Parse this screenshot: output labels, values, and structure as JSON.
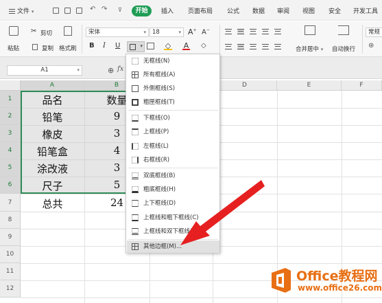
{
  "menubar": {
    "file_label": "文件",
    "tabs": [
      "开始",
      "插入",
      "页面布局",
      "公式",
      "数据",
      "审阅",
      "视图",
      "安全",
      "开发工具"
    ]
  },
  "ribbon": {
    "clipboard": {
      "cut": "剪切",
      "copy": "复制",
      "paste": "粘贴",
      "format_painter": "格式刷"
    },
    "font_name": "宋体",
    "font_size": "18",
    "merge_center": "合并居中",
    "wrap_text": "自动换行",
    "number_format": "常规"
  },
  "formula": {
    "cell_ref": "A1",
    "fx": "fx"
  },
  "sheet": {
    "columns": [
      "A",
      "B",
      "C",
      "D",
      "E",
      "F"
    ],
    "rows": [
      "1",
      "2",
      "3",
      "4",
      "5",
      "6",
      "7",
      "8",
      "9",
      "10",
      "11",
      "12"
    ],
    "cells": [
      [
        "品名",
        "数量"
      ],
      [
        "铅笔",
        "9"
      ],
      [
        "橡皮",
        "3"
      ],
      [
        "铅笔盒",
        "4"
      ],
      [
        "涂改液",
        "3"
      ],
      [
        "尺子",
        "5"
      ],
      [
        "总共",
        "24"
      ]
    ]
  },
  "border_menu": {
    "items": [
      "无框线(N)",
      "所有框线(A)",
      "外侧框线(S)",
      "粗匣框线(T)",
      "下框线(O)",
      "上框线(P)",
      "左框线(L)",
      "右框线(R)",
      "双底框线(B)",
      "粗底框线(H)",
      "上下框线(D)",
      "上框线和粗下框线(C)",
      "上框线和双下框线(U)",
      "其他边框(M)..."
    ],
    "highlighted": "其他边框(M)..."
  },
  "watermark": {
    "brand": "Office教程网",
    "site": "www.office26.com",
    "accent_color": "#e86f13"
  },
  "colors": {
    "start_tab": "#1f9d55",
    "selection_border": "#2e8b57",
    "arrow": "#e62020"
  }
}
